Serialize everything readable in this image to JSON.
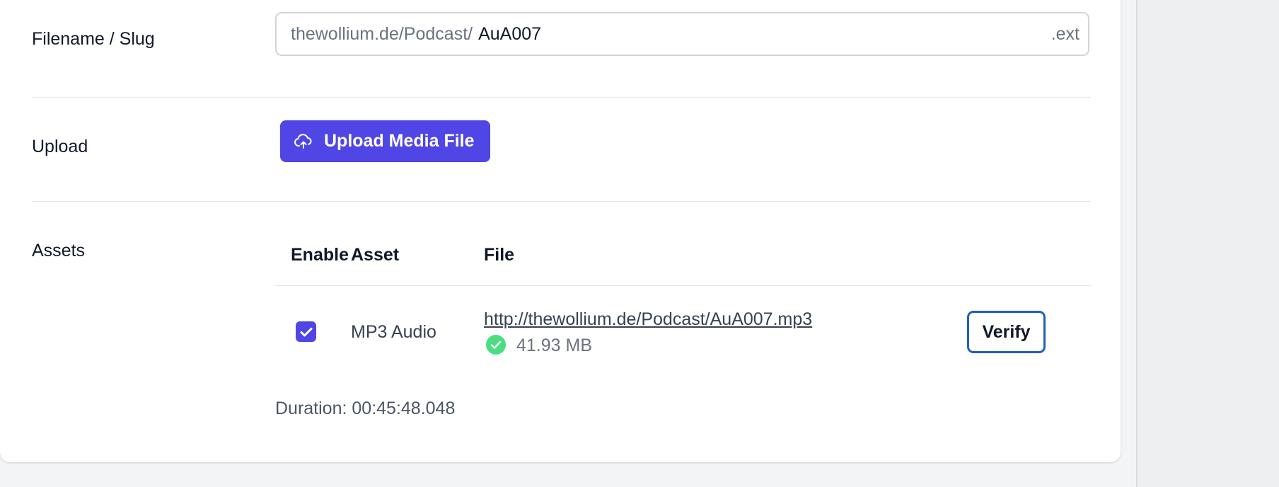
{
  "slug_row": {
    "label": "Filename / Slug",
    "prefix": "thewollium.de/Podcast/",
    "value": "AuA007",
    "suffix": ".ext"
  },
  "upload_row": {
    "label": "Upload",
    "button_label": "Upload Media File",
    "button_icon": "cloud-upload-icon"
  },
  "assets_row": {
    "label": "Assets",
    "columns": [
      "Enable",
      "Asset",
      "File"
    ],
    "rows": [
      {
        "enabled": true,
        "asset": "MP3 Audio",
        "file_url": "http://thewollium.de/Podcast/AuA007.mp3",
        "file_size": "41.93 MB",
        "status_icon": "check-circle-icon",
        "action_label": "Verify"
      }
    ],
    "duration": "Duration: 00:45:48.048"
  },
  "colors": {
    "accent": "#4f46e5",
    "success": "#4ade80",
    "verify_border": "#1d5fbf"
  }
}
